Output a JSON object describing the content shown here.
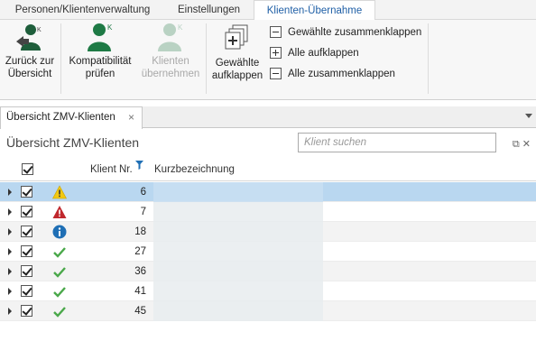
{
  "tabs": [
    {
      "label": "Personen/Klientenverwaltung"
    },
    {
      "label": "Einstellungen"
    },
    {
      "label": "Klienten-Übernahme",
      "active": true
    }
  ],
  "ribbon": {
    "back": {
      "line1": "Zurück zur",
      "line2": "Übersicht",
      "icon": "person-back-icon"
    },
    "compat": {
      "line1": "Kompatibilität",
      "line2": "prüfen",
      "icon": "person-k-icon"
    },
    "transfer": {
      "line1": "Klienten",
      "line2": "übernehmen",
      "icon": "person-k-icon",
      "disabled": true
    },
    "expand_selected": {
      "line1": "Gewählte",
      "line2": "aufklappen",
      "icon": "expand-icon"
    },
    "collapse_selected": "Gewählte zusammenklappen",
    "expand_all": "Alle aufklappen",
    "collapse_all": "Alle zusammenklappen"
  },
  "document_tab": {
    "label": "Übersicht ZMV-Klienten",
    "close": "×"
  },
  "panel": {
    "title": "Übersicht ZMV-Klienten",
    "search_placeholder": "Klient suchen",
    "icons": [
      "popout-icon",
      "close-icon"
    ]
  },
  "grid": {
    "columns": [
      "Klient Nr.",
      "Kurzbezeichnung"
    ],
    "rows": [
      {
        "nr": "6",
        "status": "warning",
        "checked": true,
        "selected": true
      },
      {
        "nr": "7",
        "status": "error",
        "checked": true
      },
      {
        "nr": "18",
        "status": "info",
        "checked": true
      },
      {
        "nr": "27",
        "status": "ok",
        "checked": true
      },
      {
        "nr": "36",
        "status": "ok",
        "checked": true
      },
      {
        "nr": "41",
        "status": "ok",
        "checked": true
      },
      {
        "nr": "45",
        "status": "ok",
        "checked": true
      }
    ]
  },
  "colors": {
    "accent": "#1f5fa6",
    "green": "#1e7a45",
    "selected_row": "#b9d7f0",
    "warning": "#f2c811",
    "error": "#c0272d",
    "info": "#1f6fb5",
    "ok": "#4aa84a"
  }
}
